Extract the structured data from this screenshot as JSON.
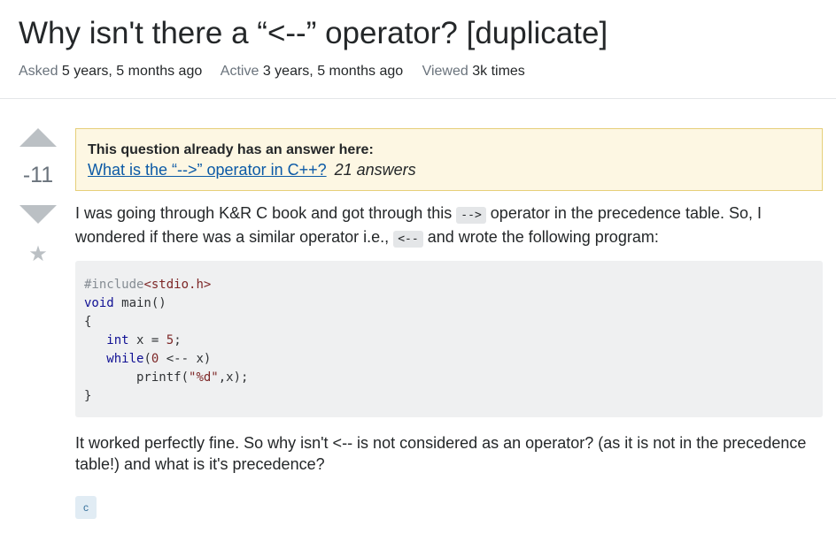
{
  "question": {
    "title": "Why isn't there a “<--” operator? [duplicate]",
    "meta": {
      "asked_label": "Asked",
      "asked_value": "5 years, 5 months ago",
      "active_label": "Active",
      "active_value": "3 years, 5 months ago",
      "viewed_label": "Viewed",
      "viewed_value": "3k times"
    },
    "votes": {
      "count": "-11",
      "up_icon": "arrow-up-icon",
      "down_icon": "arrow-down-icon",
      "favorite_glyph": "★"
    },
    "duplicate_notice": {
      "heading": "This question already has an answer here:",
      "link_text": "What is the “-->” operator in C++?",
      "answers": "21 answers"
    },
    "body": {
      "p1_a": "I was going through K&R C book and got through this",
      "p1_code1": "-->",
      "p1_b": "operator in the precedence table. So, I wondered if there was a similar operator i.e.,",
      "p1_code2": "<--",
      "p1_c": "and wrote the following program:",
      "code": {
        "l1_pre": "#include",
        "l1_hdr": "<stdio.h>",
        "l2_kw": "void",
        "l2_rest": " main()",
        "l3": "{",
        "l4_indent": "   ",
        "l4_kw": "int",
        "l4_a": " x = ",
        "l4_num": "5",
        "l4_b": ";",
        "l5_indent": "   ",
        "l5_kw": "while",
        "l5_a": "(",
        "l5_num": "0",
        "l5_b": " <-- x)",
        "l6_a": "       printf(",
        "l6_str": "\"%d\"",
        "l6_b": ",x);",
        "l7": "}"
      },
      "p2": "It worked perfectly fine. So why isn't <-- is not considered as an operator? (as it is not in the precedence table!) and what is it's precedence?"
    },
    "tags": [
      "c"
    ]
  },
  "colors": {
    "link": "#0c5aa6",
    "notice_bg": "#fdf7e3",
    "notice_border": "#e6cf79",
    "vote_arrow": "#bbc0c4",
    "code_bg": "#eff0f1",
    "tag_bg": "#e1ecf4",
    "tag_text": "#39739d"
  }
}
